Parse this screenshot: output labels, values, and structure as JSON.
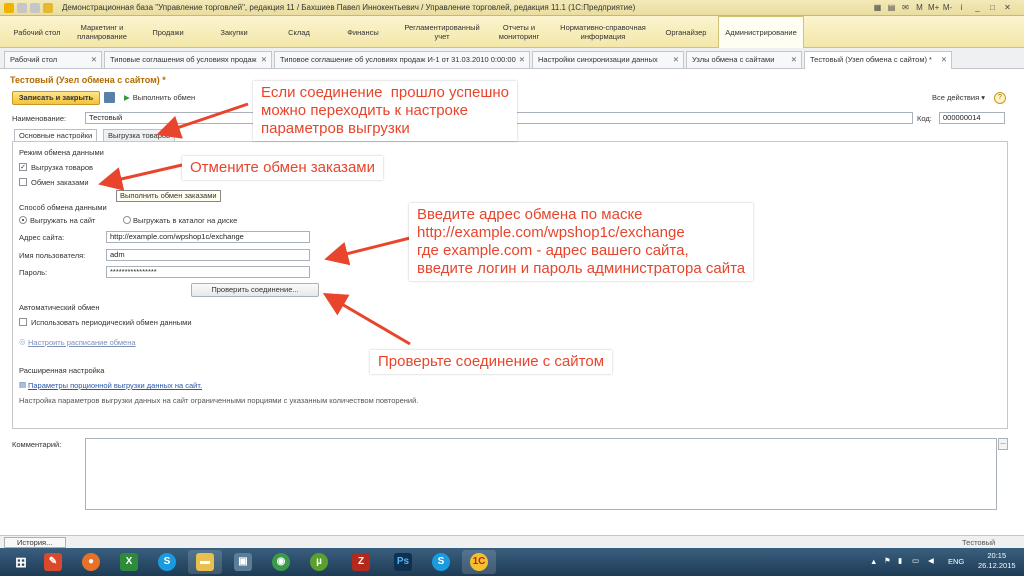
{
  "titlebar": {
    "title": "Демонстрационная база \"Управление торговлей\", редакция 11 / Бахшиев Павел Иннокентьевич / Управление торговлей, редакция 11.1 (1С:Предприятие)"
  },
  "sections": [
    "Рабочий стол",
    "Маркетинг и планирование",
    "Продажи",
    "Закупки",
    "Склад",
    "Финансы",
    "Регламентированный учет",
    "Отчеты и мониторинг",
    "Нормативно-справочная информация",
    "Органайзер",
    "Администрирование"
  ],
  "open_tabs": [
    "Рабочий стол",
    "Типовые соглашения об условиях продаж",
    "Типовое соглашение об условиях продаж И-1 от 31.03.2010 0:00:00",
    "Настройки синхронизации данных",
    "Узлы обмена с сайтами",
    "Тестовый (Узел обмена с сайтом) *"
  ],
  "form": {
    "title": "Тестовый (Узел обмена с сайтом) *",
    "save_close": "Записать и закрыть",
    "run_exchange": "Выполнить обмен",
    "all_actions": "Все действия ▾",
    "help": "?",
    "name_label": "Наименование:",
    "name_value": "Тестовый",
    "code_label": "Код:",
    "code_value": "000000014"
  },
  "inner_tabs": [
    "Основные настройки",
    "Выгрузка товаров"
  ],
  "main": {
    "exchange_mode_header": "Режим обмена данными",
    "export_goods": "Выгрузка товаров",
    "export_goods_checked": true,
    "orders_exchange": "Обмен заказами",
    "orders_exchange_checked": false,
    "tooltip": "Выполнить обмен заказами",
    "exchange_method_header": "Способ обмена данными",
    "radio_site": "Выгружать на сайт",
    "radio_site_selected": true,
    "radio_disk": "Выгружать в каталог на диске",
    "site_address_label": "Адрес сайта:",
    "site_address_value": "http://example.com/wpshop1c/exchange",
    "user_label": "Имя пользователя:",
    "user_value": "adm",
    "password_label": "Пароль:",
    "password_value": "****************",
    "check_button": "Проверить соединение...",
    "auto_header": "Автоматический обмен",
    "periodic_label": "Использовать периодический обмен данными",
    "periodic_checked": false,
    "schedule_link": "Настроить расписание обмена",
    "extended_header": "Расширенная настройка",
    "batch_link": "Параметры порционной выгрузки данных на сайт.",
    "batch_note": "Настройка параметров выгрузки данных на сайт ограниченными порциями с указанным количеством повторений."
  },
  "comment": {
    "label": "Комментарий:",
    "btn": "..."
  },
  "status": {
    "history": "История...",
    "right": "Тестовый"
  },
  "taskbar": {
    "apps": [
      "start",
      "1c-tool",
      "firefox",
      "excel",
      "skype",
      "explorer",
      "network",
      "chrome",
      "utorrent",
      "filezilla",
      "photoshop",
      "skype2",
      "1c"
    ],
    "lang": "ENG",
    "time": "20:15",
    "date": "26.12.2015"
  },
  "annotations": {
    "note1": "Если соединение  прошло успешно\nможно переходить к настроке\nпараметров выгрузки",
    "note2": "Отмените обмен заказами",
    "note3": "Введите адрес обмена по маске\nhttp://example.com/wpshop1c/exchange\nгде example.com - адрес вашего сайта,\nвведите логин и пароль администратора сайта",
    "note4": "Проверьте соединение  с сайтом",
    "color": "#e8452c"
  }
}
